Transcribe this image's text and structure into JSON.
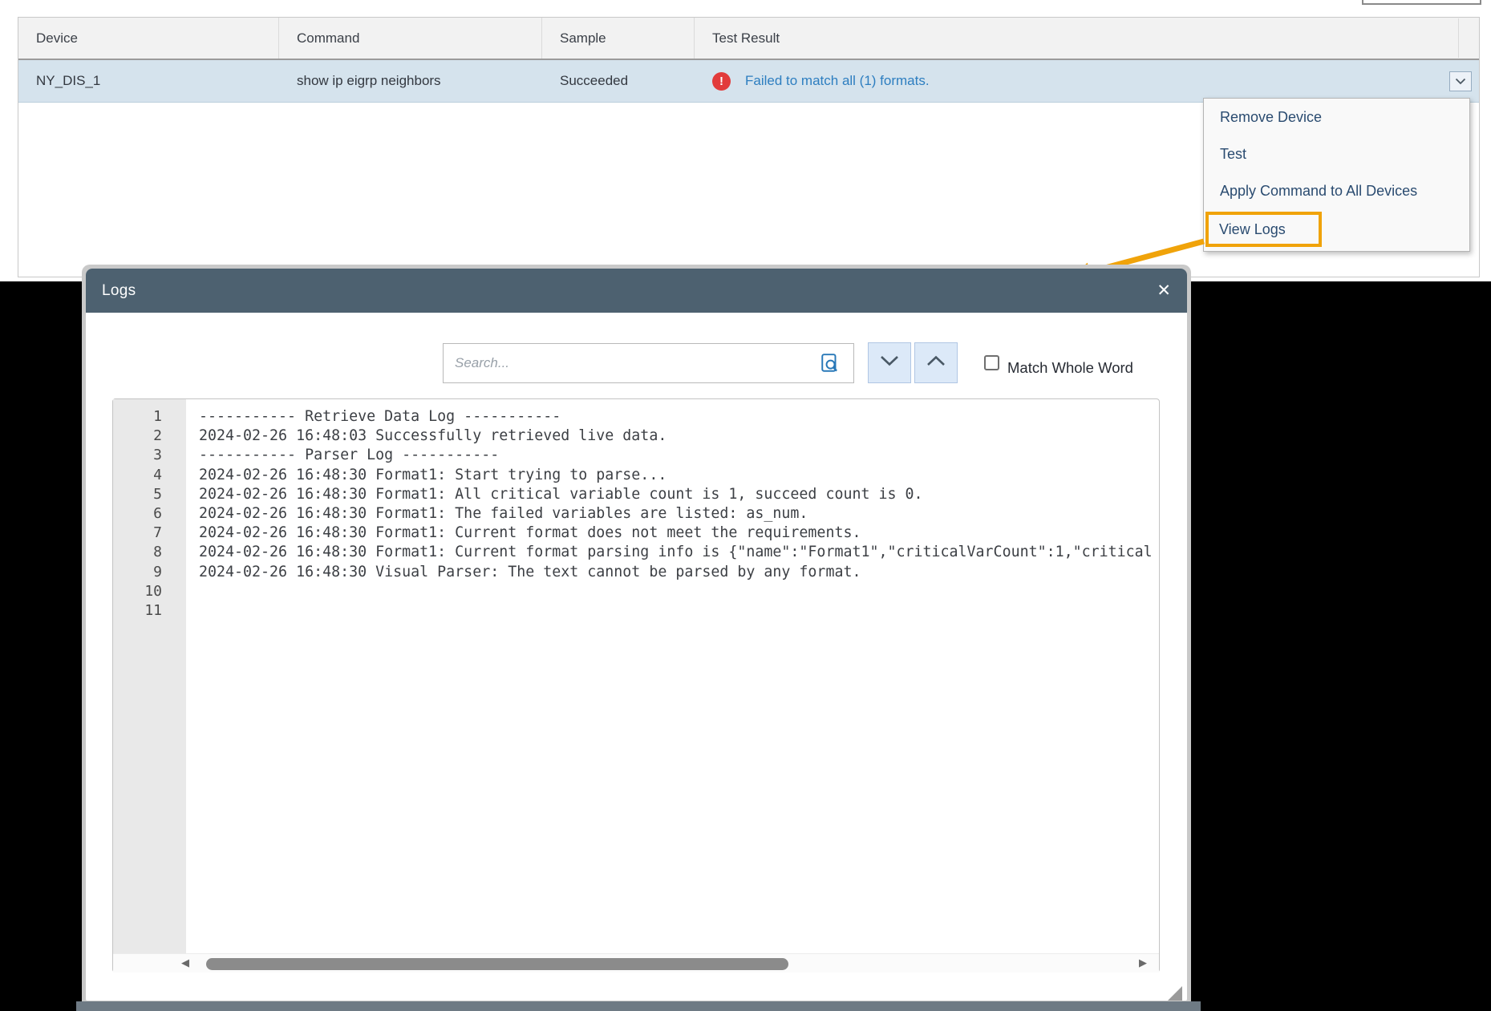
{
  "colors": {
    "accent_orange": "#f0a30a",
    "link_blue": "#2d7ec0",
    "error_red": "#e23b3b",
    "dialog_header_slate": "#4d6170",
    "row_highlight_blue": "#d5e3ed"
  },
  "table": {
    "columns": [
      "Device",
      "Command",
      "Sample",
      "Test Result"
    ],
    "row": {
      "device": "NY_DIS_1",
      "command": "show ip eigrp neighbors",
      "sample": "Succeeded",
      "error_badge": "!",
      "test_result": "Failed to match all (1) formats."
    }
  },
  "context_menu": {
    "items": [
      "Remove Device",
      "Test",
      "Apply Command to All Devices",
      "View Logs"
    ]
  },
  "dialog": {
    "title": "Logs",
    "close_glyph": "✕",
    "search_placeholder": "Search...",
    "match_whole_word_label": "Match Whole Word",
    "scroll_left_glyph": "◀",
    "scroll_right_glyph": "▶",
    "line_numbers": [
      "1",
      "2",
      "3",
      "4",
      "5",
      "6",
      "7",
      "8",
      "9",
      "10",
      "11"
    ],
    "log_lines": [
      "----------- Retrieve Data Log -----------",
      "2024-02-26 16:48:03 Successfully retrieved live data.",
      "",
      "----------- Parser Log -----------",
      "2024-02-26 16:48:30 Format1: Start trying to parse...",
      "2024-02-26 16:48:30 Format1: All critical variable count is 1, succeed count is 0.",
      "2024-02-26 16:48:30 Format1: The failed variables are listed: as_num.",
      "2024-02-26 16:48:30 Format1: Current format does not meet the requirements.",
      "2024-02-26 16:48:30 Format1: Current format parsing info is {\"name\":\"Format1\",\"criticalVarCount\":1,\"critical",
      "2024-02-26 16:48:30 Visual Parser: The text cannot be parsed by any format.",
      ""
    ]
  }
}
